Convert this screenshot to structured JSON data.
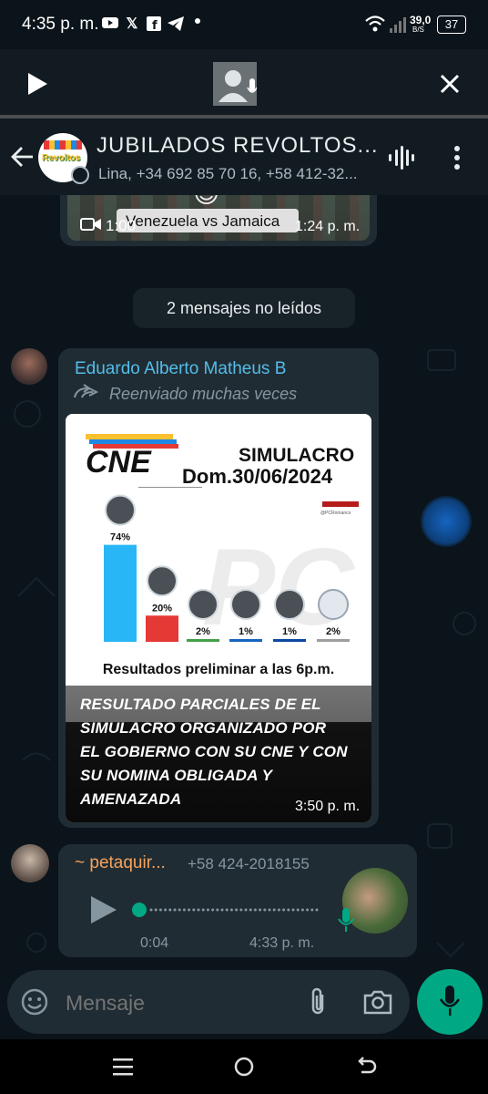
{
  "status": {
    "time": "4:35 p. m.",
    "net_speed": "39,0",
    "net_unit": "B/S",
    "battery": "37"
  },
  "header": {
    "group_name": "JUBILADOS  REVOLTOS...",
    "participants": "Lina, +34 692 85 70 16, +58 412-32...",
    "avatar_text": "Revoltos"
  },
  "prev_message": {
    "caption": "Venezuela vs Jamaica",
    "duration": "1:00",
    "time": "1:24 p. m.",
    "emoji": "😍"
  },
  "unread": {
    "label": "2 mensajes no leídos"
  },
  "message1": {
    "sender": "Eduardo Alberto Matheus B",
    "forwarded": "Reenviado muchas veces",
    "image": {
      "logo": "CNE",
      "heading": "SIMULACRO",
      "date": "Dom.30/06/2024",
      "watermark": "@PCRomanco",
      "footer": "Resultados preliminar a las 6p.m."
    },
    "caption_lines": [
      "RESULTADO PARCIALES DE EL",
      "SIMULACRO ORGANIZADO POR",
      "EL GOBIERNO CON SU CNE Y CON",
      "SU NOMINA OBLIGADA Y",
      "AMENAZADA"
    ],
    "time": "3:50 p. m."
  },
  "chart_data": {
    "type": "bar",
    "categories": [
      "1",
      "2",
      "3",
      "4",
      "5",
      "6"
    ],
    "values": [
      74,
      20,
      2,
      1,
      1,
      2
    ],
    "labels": [
      "74%",
      "20%",
      "2%",
      "1%",
      "1%",
      "2%"
    ],
    "colors": [
      "#29b6f6",
      "#e53935",
      "#43a047",
      "#1565c0",
      "#0d47a1",
      "#9e9e9e"
    ],
    "ylim": [
      0,
      80
    ]
  },
  "message2": {
    "sender": "~ petaquir...",
    "phone": "+58 424-2018155",
    "duration": "0:04",
    "time": "4:33 p. m."
  },
  "input": {
    "placeholder": "Mensaje"
  },
  "colors": {
    "accent": "#00a884",
    "bubble": "#202c33",
    "sender1": "#53bdeb",
    "sender2": "#f5a25d"
  }
}
